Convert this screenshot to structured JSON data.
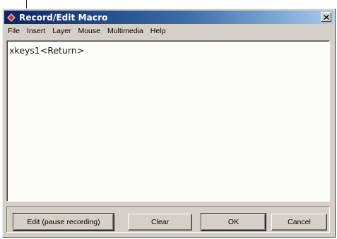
{
  "window": {
    "title": "Record/Edit Macro",
    "close_glyph": "x",
    "icon": "diamond-app-icon"
  },
  "menu": {
    "items": [
      {
        "label": "File"
      },
      {
        "label": "Insert"
      },
      {
        "label": "Layer"
      },
      {
        "label": "Mouse"
      },
      {
        "label": "Multimedia"
      },
      {
        "label": "Help"
      }
    ]
  },
  "editor": {
    "content": "xkeys1<Return>"
  },
  "buttons": {
    "edit_label": "Edit (pause recording)",
    "clear_label": "Clear",
    "ok_label": "OK",
    "cancel_label": "Cancel"
  },
  "colors": {
    "titlebar_start": "#0a246a",
    "titlebar_end": "#a6caf0",
    "face": "#d4d0c8",
    "editor_bg": "#fdfdf8"
  }
}
